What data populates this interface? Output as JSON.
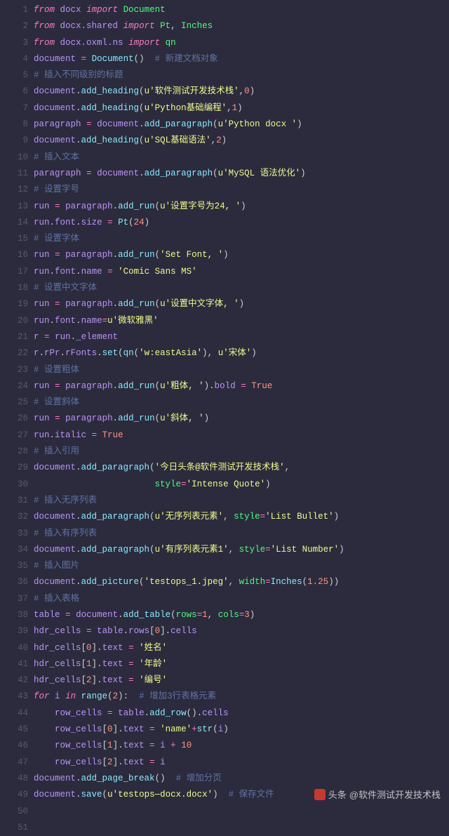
{
  "watermark": {
    "brand": "头条",
    "handle": "@软件测试开发技术栈"
  },
  "lines": [
    [
      [
        "kw",
        "from"
      ],
      [
        "pun",
        " "
      ],
      [
        "id",
        "docx"
      ],
      [
        "pun",
        " "
      ],
      [
        "kw",
        "import"
      ],
      [
        "pun",
        " "
      ],
      [
        "def",
        "Document"
      ]
    ],
    [
      [
        "kw",
        "from"
      ],
      [
        "pun",
        " "
      ],
      [
        "id",
        "docx.shared"
      ],
      [
        "pun",
        " "
      ],
      [
        "kw",
        "import"
      ],
      [
        "pun",
        " "
      ],
      [
        "def",
        "Pt"
      ],
      [
        "pun",
        ", "
      ],
      [
        "def",
        "Inches"
      ]
    ],
    [
      [
        "kw",
        "from"
      ],
      [
        "pun",
        " "
      ],
      [
        "id",
        "docx.oxml.ns"
      ],
      [
        "pun",
        " "
      ],
      [
        "kw",
        "import"
      ],
      [
        "pun",
        " "
      ],
      [
        "def",
        "qn"
      ]
    ],
    [
      [
        "id",
        "document"
      ],
      [
        "pun",
        " "
      ],
      [
        "op",
        "="
      ],
      [
        "pun",
        " "
      ],
      [
        "fn",
        "Document"
      ],
      [
        "pun",
        "()  "
      ],
      [
        "cmt",
        "# 新建文档对象"
      ]
    ],
    [
      [
        "cmt",
        "# 插入不同级别的标题"
      ]
    ],
    [
      [
        "id",
        "document"
      ],
      [
        "pun",
        "."
      ],
      [
        "fn",
        "add_heading"
      ],
      [
        "pun",
        "("
      ],
      [
        "str",
        "u'软件测试开发技术栈'"
      ],
      [
        "pun",
        ","
      ],
      [
        "num",
        "0"
      ],
      [
        "pun",
        ")"
      ]
    ],
    [
      [
        "id",
        "document"
      ],
      [
        "pun",
        "."
      ],
      [
        "fn",
        "add_heading"
      ],
      [
        "pun",
        "("
      ],
      [
        "str",
        "u'Python基础编程'"
      ],
      [
        "pun",
        ","
      ],
      [
        "num",
        "1"
      ],
      [
        "pun",
        ")"
      ]
    ],
    [
      [
        "id",
        "paragraph"
      ],
      [
        "pun",
        " "
      ],
      [
        "op",
        "="
      ],
      [
        "pun",
        " "
      ],
      [
        "id",
        "document"
      ],
      [
        "pun",
        "."
      ],
      [
        "fn",
        "add_paragraph"
      ],
      [
        "pun",
        "("
      ],
      [
        "str",
        "u'Python docx '"
      ],
      [
        "pun",
        ")"
      ]
    ],
    [
      [
        "id",
        "document"
      ],
      [
        "pun",
        "."
      ],
      [
        "fn",
        "add_heading"
      ],
      [
        "pun",
        "("
      ],
      [
        "str",
        "u'SQL基础语法'"
      ],
      [
        "pun",
        ","
      ],
      [
        "num",
        "2"
      ],
      [
        "pun",
        ")"
      ]
    ],
    [
      [
        "cmt",
        "# 插入文本"
      ]
    ],
    [
      [
        "id",
        "paragraph"
      ],
      [
        "pun",
        " "
      ],
      [
        "op",
        "="
      ],
      [
        "pun",
        " "
      ],
      [
        "id",
        "document"
      ],
      [
        "pun",
        "."
      ],
      [
        "fn",
        "add_paragraph"
      ],
      [
        "pun",
        "("
      ],
      [
        "str",
        "u'MySQL 语法优化'"
      ],
      [
        "pun",
        ")"
      ]
    ],
    [
      [
        "cmt",
        "# 设置字号"
      ]
    ],
    [
      [
        "id",
        "run"
      ],
      [
        "pun",
        " "
      ],
      [
        "op",
        "="
      ],
      [
        "pun",
        " "
      ],
      [
        "id",
        "paragraph"
      ],
      [
        "pun",
        "."
      ],
      [
        "fn",
        "add_run"
      ],
      [
        "pun",
        "("
      ],
      [
        "str",
        "u'设置字号为24, '"
      ],
      [
        "pun",
        ")"
      ]
    ],
    [
      [
        "id",
        "run"
      ],
      [
        "pun",
        "."
      ],
      [
        "id",
        "font"
      ],
      [
        "pun",
        "."
      ],
      [
        "id",
        "size"
      ],
      [
        "pun",
        " "
      ],
      [
        "op",
        "="
      ],
      [
        "pun",
        " "
      ],
      [
        "fn",
        "Pt"
      ],
      [
        "pun",
        "("
      ],
      [
        "num",
        "24"
      ],
      [
        "pun",
        ")"
      ]
    ],
    [
      [
        "cmt",
        "# 设置字体"
      ]
    ],
    [
      [
        "id",
        "run"
      ],
      [
        "pun",
        " "
      ],
      [
        "op",
        "="
      ],
      [
        "pun",
        " "
      ],
      [
        "id",
        "paragraph"
      ],
      [
        "pun",
        "."
      ],
      [
        "fn",
        "add_run"
      ],
      [
        "pun",
        "("
      ],
      [
        "str",
        "'Set Font, '"
      ],
      [
        "pun",
        ")"
      ]
    ],
    [
      [
        "id",
        "run"
      ],
      [
        "pun",
        "."
      ],
      [
        "id",
        "font"
      ],
      [
        "pun",
        "."
      ],
      [
        "id",
        "name"
      ],
      [
        "pun",
        " "
      ],
      [
        "op",
        "="
      ],
      [
        "pun",
        " "
      ],
      [
        "str",
        "'Comic Sans MS'"
      ]
    ],
    [
      [
        "cmt",
        "# 设置中文字体"
      ]
    ],
    [
      [
        "id",
        "run"
      ],
      [
        "pun",
        " "
      ],
      [
        "op",
        "="
      ],
      [
        "pun",
        " "
      ],
      [
        "id",
        "paragraph"
      ],
      [
        "pun",
        "."
      ],
      [
        "fn",
        "add_run"
      ],
      [
        "pun",
        "("
      ],
      [
        "str",
        "u'设置中文字体, '"
      ],
      [
        "pun",
        ")"
      ]
    ],
    [
      [
        "id",
        "run"
      ],
      [
        "pun",
        "."
      ],
      [
        "id",
        "font"
      ],
      [
        "pun",
        "."
      ],
      [
        "id",
        "name"
      ],
      [
        "op",
        "="
      ],
      [
        "str",
        "u'微软雅黑'"
      ]
    ],
    [
      [
        "id",
        "r"
      ],
      [
        "pun",
        " "
      ],
      [
        "op",
        "="
      ],
      [
        "pun",
        " "
      ],
      [
        "id",
        "run"
      ],
      [
        "pun",
        "."
      ],
      [
        "id",
        "_element"
      ]
    ],
    [
      [
        "id",
        "r"
      ],
      [
        "pun",
        "."
      ],
      [
        "id",
        "rPr"
      ],
      [
        "pun",
        "."
      ],
      [
        "id",
        "rFonts"
      ],
      [
        "pun",
        "."
      ],
      [
        "fn",
        "set"
      ],
      [
        "pun",
        "("
      ],
      [
        "fn",
        "qn"
      ],
      [
        "pun",
        "("
      ],
      [
        "str",
        "'w:eastAsia'"
      ],
      [
        "pun",
        "), "
      ],
      [
        "str",
        "u'宋体'"
      ],
      [
        "pun",
        ")"
      ]
    ],
    [
      [
        "cmt",
        "# 设置粗体"
      ]
    ],
    [
      [
        "id",
        "run"
      ],
      [
        "pun",
        " "
      ],
      [
        "op",
        "="
      ],
      [
        "pun",
        " "
      ],
      [
        "id",
        "paragraph"
      ],
      [
        "pun",
        "."
      ],
      [
        "fn",
        "add_run"
      ],
      [
        "pun",
        "("
      ],
      [
        "str",
        "u'粗体, '"
      ],
      [
        "pun",
        ")."
      ],
      [
        "id",
        "bold"
      ],
      [
        "pun",
        " "
      ],
      [
        "op",
        "="
      ],
      [
        "pun",
        " "
      ],
      [
        "val",
        "True"
      ]
    ],
    [
      [
        "cmt",
        "# 设置斜体"
      ]
    ],
    [
      [
        "id",
        "run"
      ],
      [
        "pun",
        " "
      ],
      [
        "op",
        "="
      ],
      [
        "pun",
        " "
      ],
      [
        "id",
        "paragraph"
      ],
      [
        "pun",
        "."
      ],
      [
        "fn",
        "add_run"
      ],
      [
        "pun",
        "("
      ],
      [
        "str",
        "u'斜体, '"
      ],
      [
        "pun",
        ")"
      ]
    ],
    [
      [
        "id",
        "run"
      ],
      [
        "pun",
        "."
      ],
      [
        "id",
        "italic"
      ],
      [
        "pun",
        " "
      ],
      [
        "op",
        "="
      ],
      [
        "pun",
        " "
      ],
      [
        "val",
        "True"
      ]
    ],
    [
      [
        "cmt",
        "# 插入引用"
      ]
    ],
    [
      [
        "id",
        "document"
      ],
      [
        "pun",
        "."
      ],
      [
        "fn",
        "add_paragraph"
      ],
      [
        "pun",
        "("
      ],
      [
        "str",
        "'今日头条@软件测试开发技术栈'"
      ],
      [
        "pun",
        ","
      ]
    ],
    [
      [
        "pun",
        "                       "
      ],
      [
        "prop",
        "style"
      ],
      [
        "op",
        "="
      ],
      [
        "str",
        "'Intense Quote'"
      ],
      [
        "pun",
        ")"
      ]
    ],
    [
      [
        "cmt",
        "# 插入无序列表"
      ]
    ],
    [
      [
        "id",
        "document"
      ],
      [
        "pun",
        "."
      ],
      [
        "fn",
        "add_paragraph"
      ],
      [
        "pun",
        "("
      ],
      [
        "str",
        "u'无序列表元素'"
      ],
      [
        "pun",
        ", "
      ],
      [
        "prop",
        "style"
      ],
      [
        "op",
        "="
      ],
      [
        "str",
        "'List Bullet'"
      ],
      [
        "pun",
        ")"
      ]
    ],
    [
      [
        "cmt",
        "# 插入有序列表"
      ]
    ],
    [
      [
        "id",
        "document"
      ],
      [
        "pun",
        "."
      ],
      [
        "fn",
        "add_paragraph"
      ],
      [
        "pun",
        "("
      ],
      [
        "str",
        "u'有序列表元素1'"
      ],
      [
        "pun",
        ", "
      ],
      [
        "prop",
        "style"
      ],
      [
        "op",
        "="
      ],
      [
        "str",
        "'List Number'"
      ],
      [
        "pun",
        ")"
      ]
    ],
    [
      [
        "cmt",
        "# 插入图片"
      ]
    ],
    [
      [
        "id",
        "document"
      ],
      [
        "pun",
        "."
      ],
      [
        "fn",
        "add_picture"
      ],
      [
        "pun",
        "("
      ],
      [
        "str",
        "'testops_1.jpeg'"
      ],
      [
        "pun",
        ", "
      ],
      [
        "prop",
        "width"
      ],
      [
        "op",
        "="
      ],
      [
        "fn",
        "Inches"
      ],
      [
        "pun",
        "("
      ],
      [
        "num",
        "1.25"
      ],
      [
        "pun",
        "))"
      ]
    ],
    [
      [
        "cmt",
        "# 插入表格"
      ]
    ],
    [
      [
        "id",
        "table"
      ],
      [
        "pun",
        " "
      ],
      [
        "op",
        "="
      ],
      [
        "pun",
        " "
      ],
      [
        "id",
        "document"
      ],
      [
        "pun",
        "."
      ],
      [
        "fn",
        "add_table"
      ],
      [
        "pun",
        "("
      ],
      [
        "prop",
        "rows"
      ],
      [
        "op",
        "="
      ],
      [
        "num",
        "1"
      ],
      [
        "pun",
        ", "
      ],
      [
        "prop",
        "cols"
      ],
      [
        "op",
        "="
      ],
      [
        "num",
        "3"
      ],
      [
        "pun",
        ")"
      ]
    ],
    [
      [
        "id",
        "hdr_cells"
      ],
      [
        "pun",
        " "
      ],
      [
        "op",
        "="
      ],
      [
        "pun",
        " "
      ],
      [
        "id",
        "table"
      ],
      [
        "pun",
        "."
      ],
      [
        "id",
        "rows"
      ],
      [
        "pun",
        "["
      ],
      [
        "num",
        "0"
      ],
      [
        "pun",
        "]."
      ],
      [
        "id",
        "cells"
      ]
    ],
    [
      [
        "id",
        "hdr_cells"
      ],
      [
        "pun",
        "["
      ],
      [
        "num",
        "0"
      ],
      [
        "pun",
        "]."
      ],
      [
        "id",
        "text"
      ],
      [
        "pun",
        " "
      ],
      [
        "op",
        "="
      ],
      [
        "pun",
        " "
      ],
      [
        "str",
        "'姓名'"
      ]
    ],
    [
      [
        "id",
        "hdr_cells"
      ],
      [
        "pun",
        "["
      ],
      [
        "num",
        "1"
      ],
      [
        "pun",
        "]."
      ],
      [
        "id",
        "text"
      ],
      [
        "pun",
        " "
      ],
      [
        "op",
        "="
      ],
      [
        "pun",
        " "
      ],
      [
        "str",
        "'年龄'"
      ]
    ],
    [
      [
        "id",
        "hdr_cells"
      ],
      [
        "pun",
        "["
      ],
      [
        "num",
        "2"
      ],
      [
        "pun",
        "]."
      ],
      [
        "id",
        "text"
      ],
      [
        "pun",
        " "
      ],
      [
        "op",
        "="
      ],
      [
        "pun",
        " "
      ],
      [
        "str",
        "'编号'"
      ]
    ],
    [
      [
        "kw",
        "for"
      ],
      [
        "pun",
        " "
      ],
      [
        "id",
        "i"
      ],
      [
        "pun",
        " "
      ],
      [
        "kw",
        "in"
      ],
      [
        "pun",
        " "
      ],
      [
        "fn",
        "range"
      ],
      [
        "pun",
        "("
      ],
      [
        "num",
        "2"
      ],
      [
        "pun",
        "):  "
      ],
      [
        "cmt",
        "# 增加3行表格元素"
      ]
    ],
    [
      [
        "pun",
        "    "
      ],
      [
        "id",
        "row_cells"
      ],
      [
        "pun",
        " "
      ],
      [
        "op",
        "="
      ],
      [
        "pun",
        " "
      ],
      [
        "id",
        "table"
      ],
      [
        "pun",
        "."
      ],
      [
        "fn",
        "add_row"
      ],
      [
        "pun",
        "()."
      ],
      [
        "id",
        "cells"
      ]
    ],
    [
      [
        "pun",
        "    "
      ],
      [
        "id",
        "row_cells"
      ],
      [
        "pun",
        "["
      ],
      [
        "num",
        "0"
      ],
      [
        "pun",
        "]."
      ],
      [
        "id",
        "text"
      ],
      [
        "pun",
        " "
      ],
      [
        "op",
        "="
      ],
      [
        "pun",
        " "
      ],
      [
        "str",
        "'name'"
      ],
      [
        "op",
        "+"
      ],
      [
        "fn",
        "str"
      ],
      [
        "pun",
        "("
      ],
      [
        "id",
        "i"
      ],
      [
        "pun",
        ")"
      ]
    ],
    [
      [
        "pun",
        "    "
      ],
      [
        "id",
        "row_cells"
      ],
      [
        "pun",
        "["
      ],
      [
        "num",
        "1"
      ],
      [
        "pun",
        "]."
      ],
      [
        "id",
        "text"
      ],
      [
        "pun",
        " "
      ],
      [
        "op",
        "="
      ],
      [
        "pun",
        " "
      ],
      [
        "id",
        "i"
      ],
      [
        "pun",
        " "
      ],
      [
        "op",
        "+"
      ],
      [
        "pun",
        " "
      ],
      [
        "num",
        "10"
      ]
    ],
    [
      [
        "pun",
        "    "
      ],
      [
        "id",
        "row_cells"
      ],
      [
        "pun",
        "["
      ],
      [
        "num",
        "2"
      ],
      [
        "pun",
        "]."
      ],
      [
        "id",
        "text"
      ],
      [
        "pun",
        " "
      ],
      [
        "op",
        "="
      ],
      [
        "pun",
        " "
      ],
      [
        "id",
        "i"
      ]
    ],
    [
      [
        "id",
        "document"
      ],
      [
        "pun",
        "."
      ],
      [
        "fn",
        "add_page_break"
      ],
      [
        "pun",
        "()  "
      ],
      [
        "cmt",
        "# 增加分页"
      ]
    ],
    [
      [
        "id",
        "document"
      ],
      [
        "pun",
        "."
      ],
      [
        "fn",
        "save"
      ],
      [
        "pun",
        "("
      ],
      [
        "str",
        "u'testops—docx.docx'"
      ],
      [
        "pun",
        ")  "
      ],
      [
        "cmt",
        "# 保存文件"
      ]
    ],
    [],
    []
  ]
}
